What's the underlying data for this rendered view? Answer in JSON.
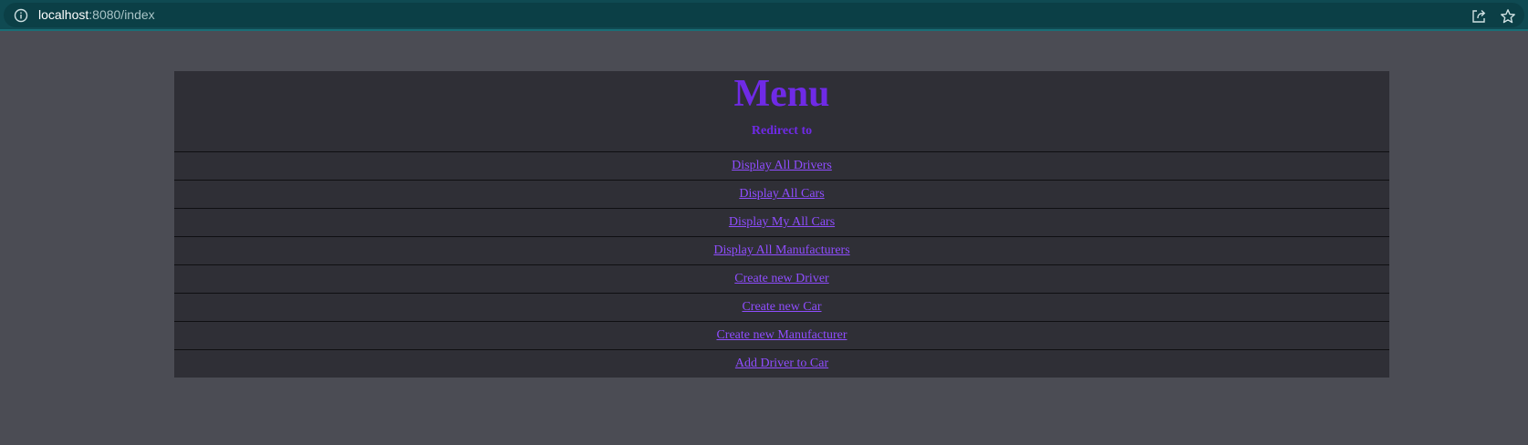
{
  "browser": {
    "url_host": "localhost",
    "url_rest": ":8080/index",
    "icons": [
      "info-icon",
      "share-icon",
      "star-icon"
    ]
  },
  "page": {
    "title": "Menu",
    "subtitle": "Redirect to",
    "links": [
      "Display All Drivers",
      "Display All Cars",
      "Display My All Cars",
      "Display All Manufacturers",
      "Create new Driver",
      "Create new Car",
      "Create new Manufacturer",
      "Add Driver to Car"
    ]
  },
  "colors": {
    "page_background": "#4b4c54",
    "table_background": "#2f2f36",
    "heading": "#6f2ae6",
    "link": "#8f4dff",
    "browser_bar": "#0f4a52"
  }
}
